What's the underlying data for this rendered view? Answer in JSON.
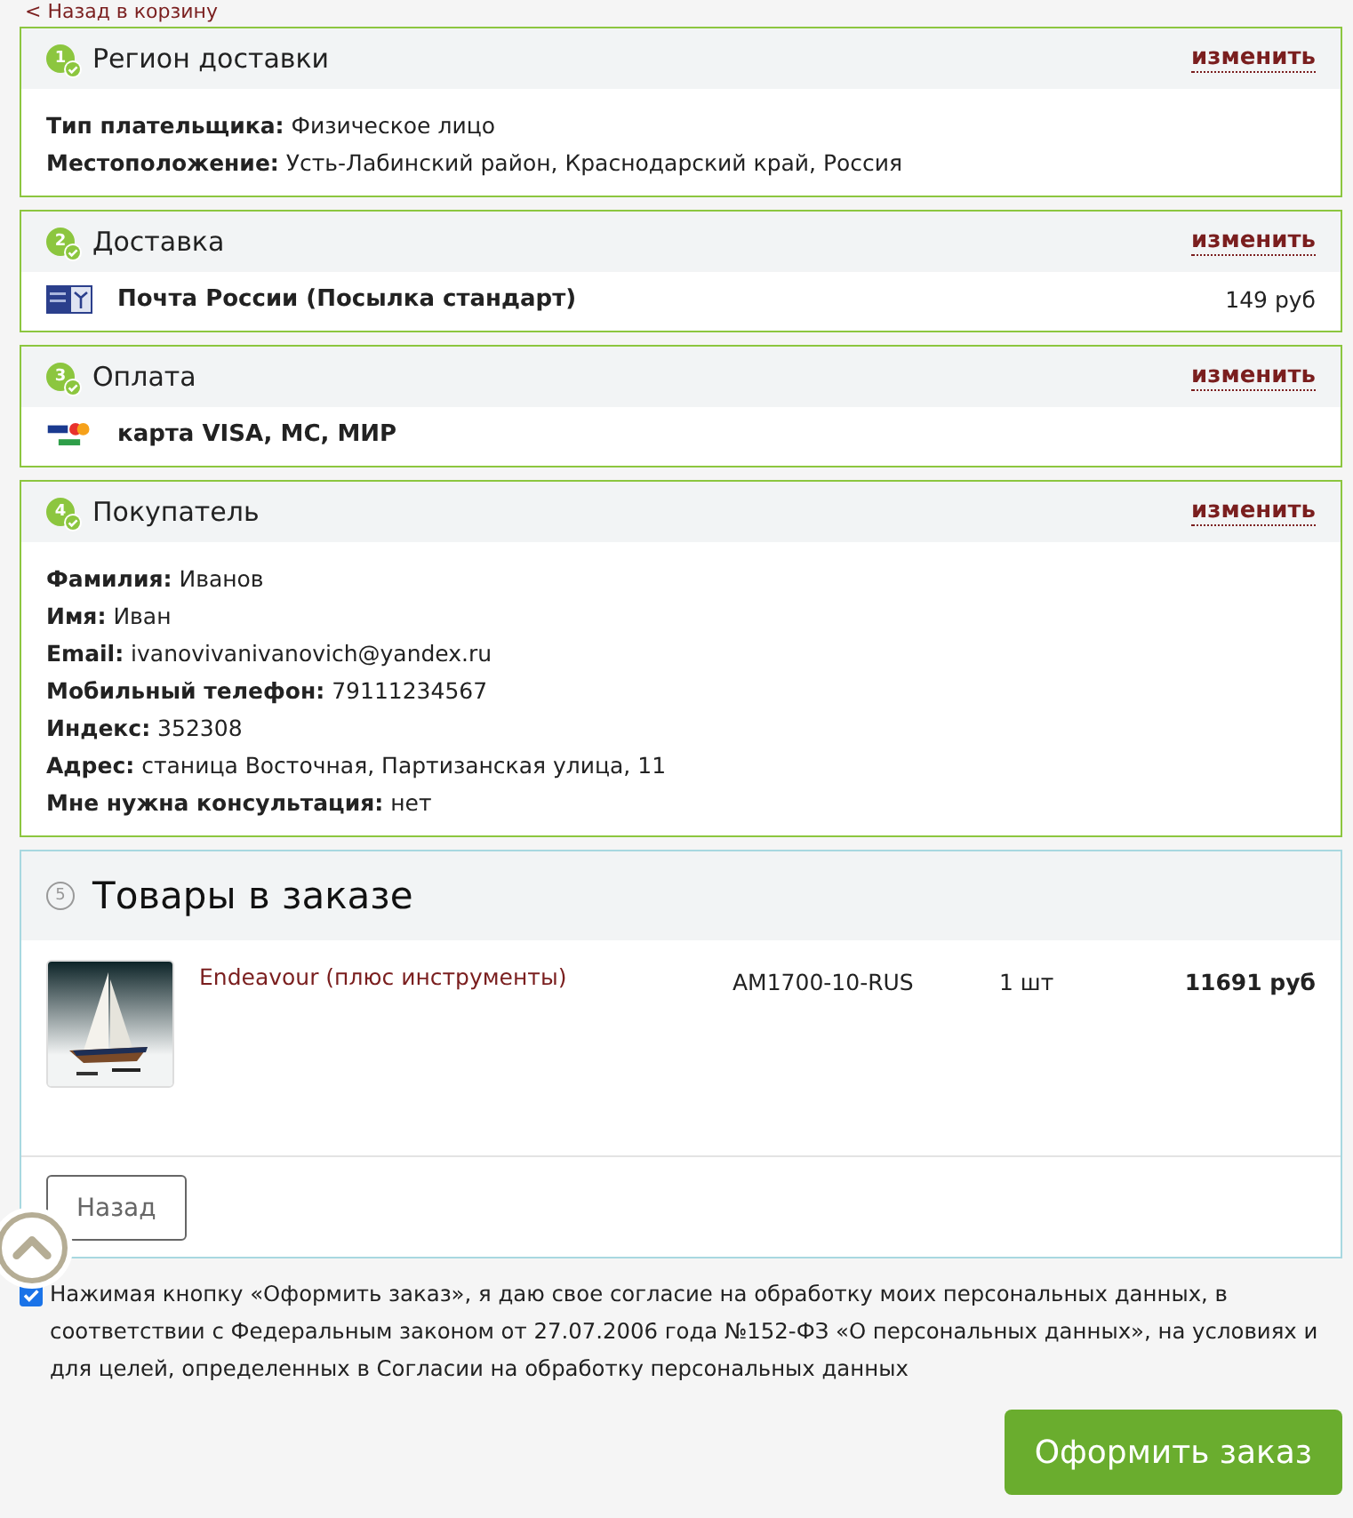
{
  "back_link": "< Назад в корзину",
  "sections": [
    {
      "kind": "fields",
      "number": "1",
      "completed": true,
      "title": "Регион доставки",
      "edit_link": "изменить",
      "fields": [
        {
          "label": "Тип плательщика:",
          "value": "Физическое лицо"
        },
        {
          "label": "Местоположение:",
          "value": "Усть-Лабинский район, Краснодарский край, Россия"
        }
      ]
    },
    {
      "kind": "delivery",
      "number": "2",
      "completed": true,
      "title": "Доставка",
      "edit_link": "изменить",
      "name": "Почта России (Посылка стандарт)",
      "price": "149 руб"
    },
    {
      "kind": "payment",
      "number": "3",
      "completed": true,
      "title": "Оплата",
      "edit_link": "изменить",
      "name": "карта VISA, MC, МИР"
    },
    {
      "kind": "fields",
      "number": "4",
      "completed": true,
      "title": "Покупатель",
      "edit_link": "изменить",
      "fields": [
        {
          "label": "Фамилия:",
          "value": "Иванов"
        },
        {
          "label": "Имя:",
          "value": "Иван"
        },
        {
          "label": "Email:",
          "value": "ivanovivanivanovich@yandex.ru"
        },
        {
          "label": "Мобильный телефон:",
          "value": "79111234567"
        },
        {
          "label": "Индекс:",
          "value": "352308"
        },
        {
          "label": "Адрес:",
          "value": "станица Восточная, Партизанская улица, 11"
        },
        {
          "label": "Мне нужна консультация:",
          "value": "нет"
        }
      ]
    },
    {
      "kind": "products",
      "number": "5",
      "completed": false,
      "title": "Товары в заказе",
      "products": [
        {
          "name": "Endeavour (плюс инструменты)",
          "sku": "AM1700-10-RUS",
          "quantity": "1 шт",
          "price": "11691 руб"
        }
      ],
      "back_button": "Назад"
    }
  ],
  "consent": {
    "checked": true,
    "text": "Нажимая кнопку «Оформить заказ», я даю свое согласие на обработку моих персональных данных, в соответствии с Федеральным законом от 27.07.2006 года №152-ФЗ «О персональных данных», на условиях и для целей, определенных в Согласии на обработку персональных данных"
  },
  "submit_button": "Оформить заказ"
}
